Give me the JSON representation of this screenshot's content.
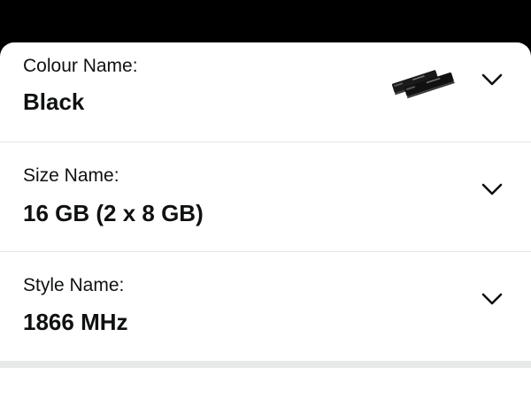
{
  "variations": [
    {
      "label": "Colour Name:",
      "value": "Black",
      "thumbnail": "black-ram-module-pair"
    },
    {
      "label": "Size Name:",
      "value": "16 GB (2 x 8 GB)"
    },
    {
      "label": "Style Name:",
      "value": "1866 MHz"
    }
  ],
  "icons": {
    "expand": "chevron-down-icon"
  },
  "colors": {
    "text": "#0f1111",
    "divider": "#e3e6e6",
    "background": "#ffffff",
    "top_bar": "#000000"
  }
}
